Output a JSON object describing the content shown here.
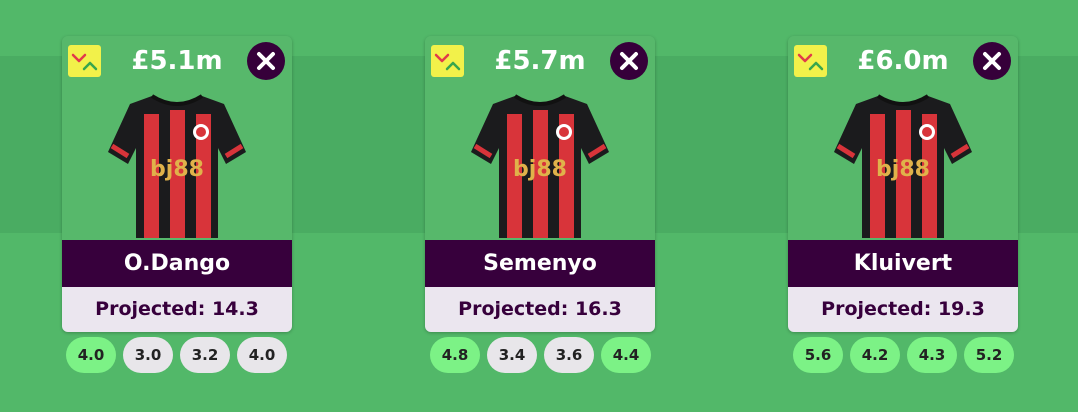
{
  "colors": {
    "background": "#4fb466",
    "card_top": "#57b86b",
    "name_bar": "#37003c",
    "projection_bar": "#ebe6ef",
    "swap_badge": "#f2f14a",
    "fixture_easy": "#7cf286",
    "fixture_neutral": "#e8e6ea"
  },
  "players": [
    {
      "price": "£5.1m",
      "name": "O.Dango",
      "projected": "Projected: 14.3",
      "swap_icon": "swap-arrows-icon",
      "remove_icon": "close-icon",
      "shirt_text": "bj88",
      "fixtures": [
        {
          "value": "4.0",
          "tone": "green"
        },
        {
          "value": "3.0",
          "tone": "grey"
        },
        {
          "value": "3.2",
          "tone": "grey"
        },
        {
          "value": "4.0",
          "tone": "grey"
        }
      ]
    },
    {
      "price": "£5.7m",
      "name": "Semenyo",
      "projected": "Projected: 16.3",
      "swap_icon": "swap-arrows-icon",
      "remove_icon": "close-icon",
      "shirt_text": "bj88",
      "fixtures": [
        {
          "value": "4.8",
          "tone": "green"
        },
        {
          "value": "3.4",
          "tone": "grey"
        },
        {
          "value": "3.6",
          "tone": "grey"
        },
        {
          "value": "4.4",
          "tone": "green"
        }
      ]
    },
    {
      "price": "£6.0m",
      "name": "Kluivert",
      "projected": "Projected: 19.3",
      "swap_icon": "swap-arrows-icon",
      "remove_icon": "close-icon",
      "shirt_text": "bj88",
      "fixtures": [
        {
          "value": "5.6",
          "tone": "green"
        },
        {
          "value": "4.2",
          "tone": "green"
        },
        {
          "value": "4.3",
          "tone": "green"
        },
        {
          "value": "5.2",
          "tone": "green"
        }
      ]
    }
  ]
}
